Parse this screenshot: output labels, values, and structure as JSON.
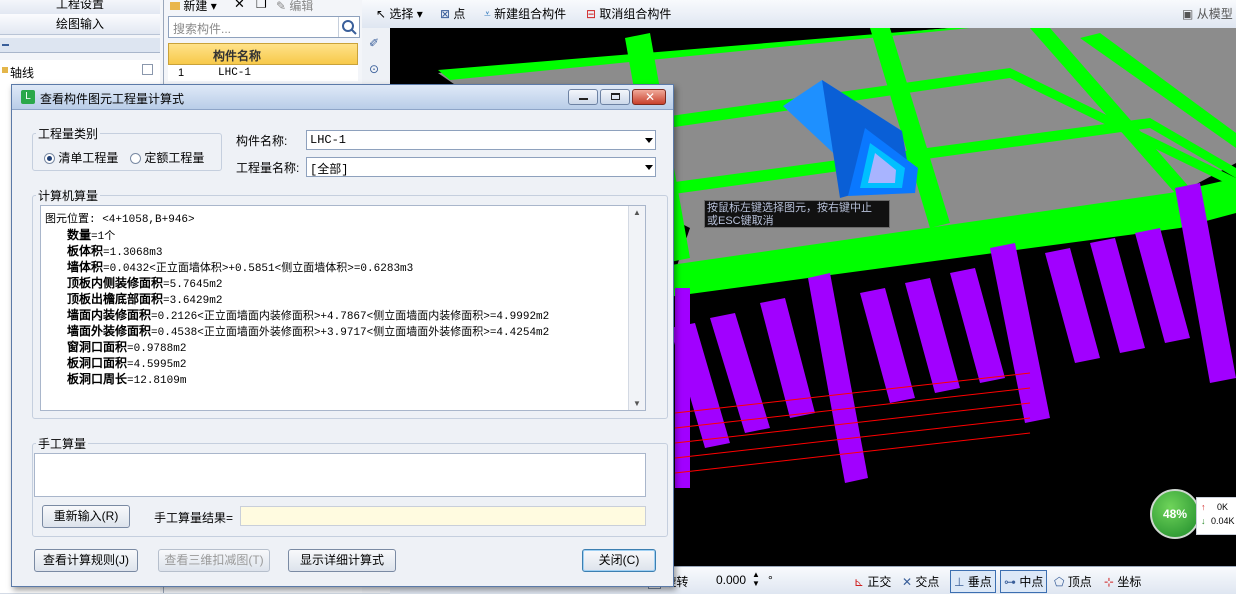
{
  "leftnav": {
    "top_item_1": "工程设置",
    "top_item_2": "绘图输入",
    "tree_item": "轴线"
  },
  "components": {
    "new_label": "新建",
    "edit_label": "编辑",
    "search_placeholder": "搜索构件...",
    "column_header": "构件名称",
    "rows": [
      {
        "index": "1",
        "name": "LHC-1"
      }
    ]
  },
  "toolbar": {
    "select": "选择",
    "point": "点",
    "new_group": "新建组合构件",
    "cancel_group": "取消组合构件",
    "from_model": "从模型"
  },
  "viewport": {
    "tooltip_line1": "按鼠标左键选择图元，按右键中止",
    "tooltip_line2": "或ESC键取消",
    "gauge_percent": "48%",
    "net_up": "0K",
    "net_down": "0.04K"
  },
  "statusbar": {
    "rotate_label": "旋转",
    "rotate_value": "0.000",
    "ortho": "正交",
    "intersection": "交点",
    "perpendicular": "垂点",
    "midpoint": "中点",
    "vertex": "顶点",
    "coordinate": "坐标"
  },
  "dialog": {
    "title": "查看构件图元工程量计算式",
    "quantity_type_label": "工程量类别",
    "radio_list": "清单工程量",
    "radio_quota": "定额工程量",
    "component_name_label": "构件名称:",
    "component_name_value": "LHC-1",
    "quantity_name_label": "工程量名称:",
    "quantity_name_value": "[全部]",
    "computer_calc_label": "计算机算量",
    "calc_lines": [
      {
        "label": "图元位置:",
        "value": " <4+1058,B+946>",
        "indent": false,
        "bold": false
      },
      {
        "label": "数量",
        "value": "=1个",
        "indent": true,
        "bold": true
      },
      {
        "label": "板体积",
        "value": "=1.3068m3",
        "indent": true,
        "bold": true
      },
      {
        "label": "墙体积",
        "value": "=0.0432<正立面墙体积>+0.5851<侧立面墙体积>=0.6283m3",
        "indent": true,
        "bold": true
      },
      {
        "label": "顶板内侧装修面积",
        "value": "=5.7645m2",
        "indent": true,
        "bold": true
      },
      {
        "label": "顶板出檐底部面积",
        "value": "=3.6429m2",
        "indent": true,
        "bold": true
      },
      {
        "label": "墙面内装修面积",
        "value": "=0.2126<正立面墙面内装修面积>+4.7867<侧立面墙面内装修面积>=4.9992m2",
        "indent": true,
        "bold": true
      },
      {
        "label": "墙面外装修面积",
        "value": "=0.4538<正立面墙面外装修面积>+3.9717<侧立面墙面外装修面积>=4.4254m2",
        "indent": true,
        "bold": true
      },
      {
        "label": "窗洞口面积",
        "value": "=0.9788m2",
        "indent": true,
        "bold": true
      },
      {
        "label": "板洞口面积",
        "value": "=4.5995m2",
        "indent": true,
        "bold": true
      },
      {
        "label": "板洞口周长",
        "value": "=12.8109m",
        "indent": true,
        "bold": true
      }
    ],
    "manual_calc_label": "手工算量",
    "reenter_button": "重新输入(R)",
    "manual_result_label": "手工算量结果=",
    "manual_result_value": "",
    "view_rules_button": "查看计算规则(J)",
    "view_3d_button": "查看三维扣减图(T)",
    "show_detail_button": "显示详细计算式",
    "close_button": "关闭(C)"
  },
  "colors": {
    "slab_grey": "#8c8c8c",
    "beam_green": "#00ff00",
    "column_purple": "#a100ff",
    "dormer_blue": "#1e90ff",
    "grid_red": "#ff0000"
  }
}
